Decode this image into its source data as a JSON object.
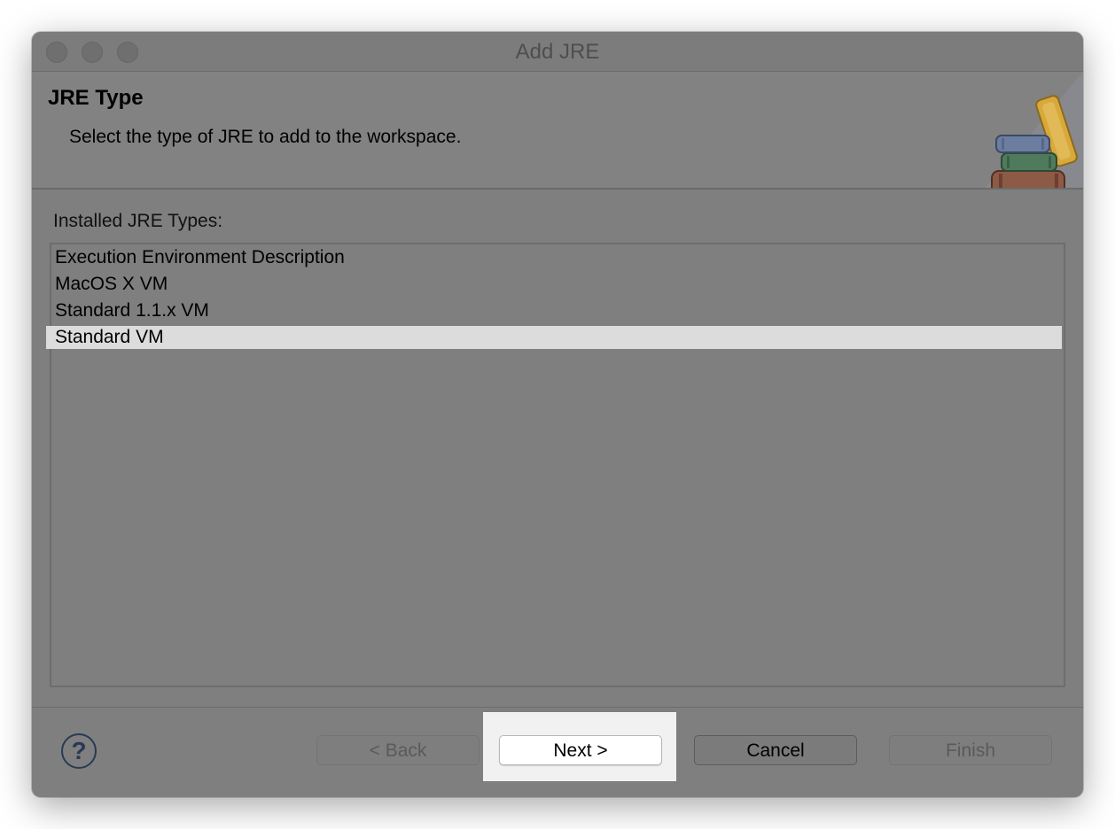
{
  "window": {
    "title": "Add JRE"
  },
  "banner": {
    "title": "JRE Type",
    "description": "Select the type of JRE to add to the workspace.",
    "icon": "jre-books-icon"
  },
  "list": {
    "label": "Installed JRE Types:",
    "items": [
      {
        "label": "Execution Environment Description",
        "selected": false
      },
      {
        "label": "MacOS X VM",
        "selected": false
      },
      {
        "label": "Standard 1.1.x VM",
        "selected": false
      },
      {
        "label": "Standard VM",
        "selected": true
      }
    ]
  },
  "buttons": {
    "help_icon": "help-icon",
    "help_glyph": "?",
    "back": "< Back",
    "next": "Next >",
    "cancel": "Cancel",
    "finish": "Finish",
    "back_enabled": false,
    "finish_enabled": false
  },
  "colors": {
    "overlay": "#7f7f7f",
    "selection": "#dcdcdc",
    "primary_button": "#ffffff"
  }
}
